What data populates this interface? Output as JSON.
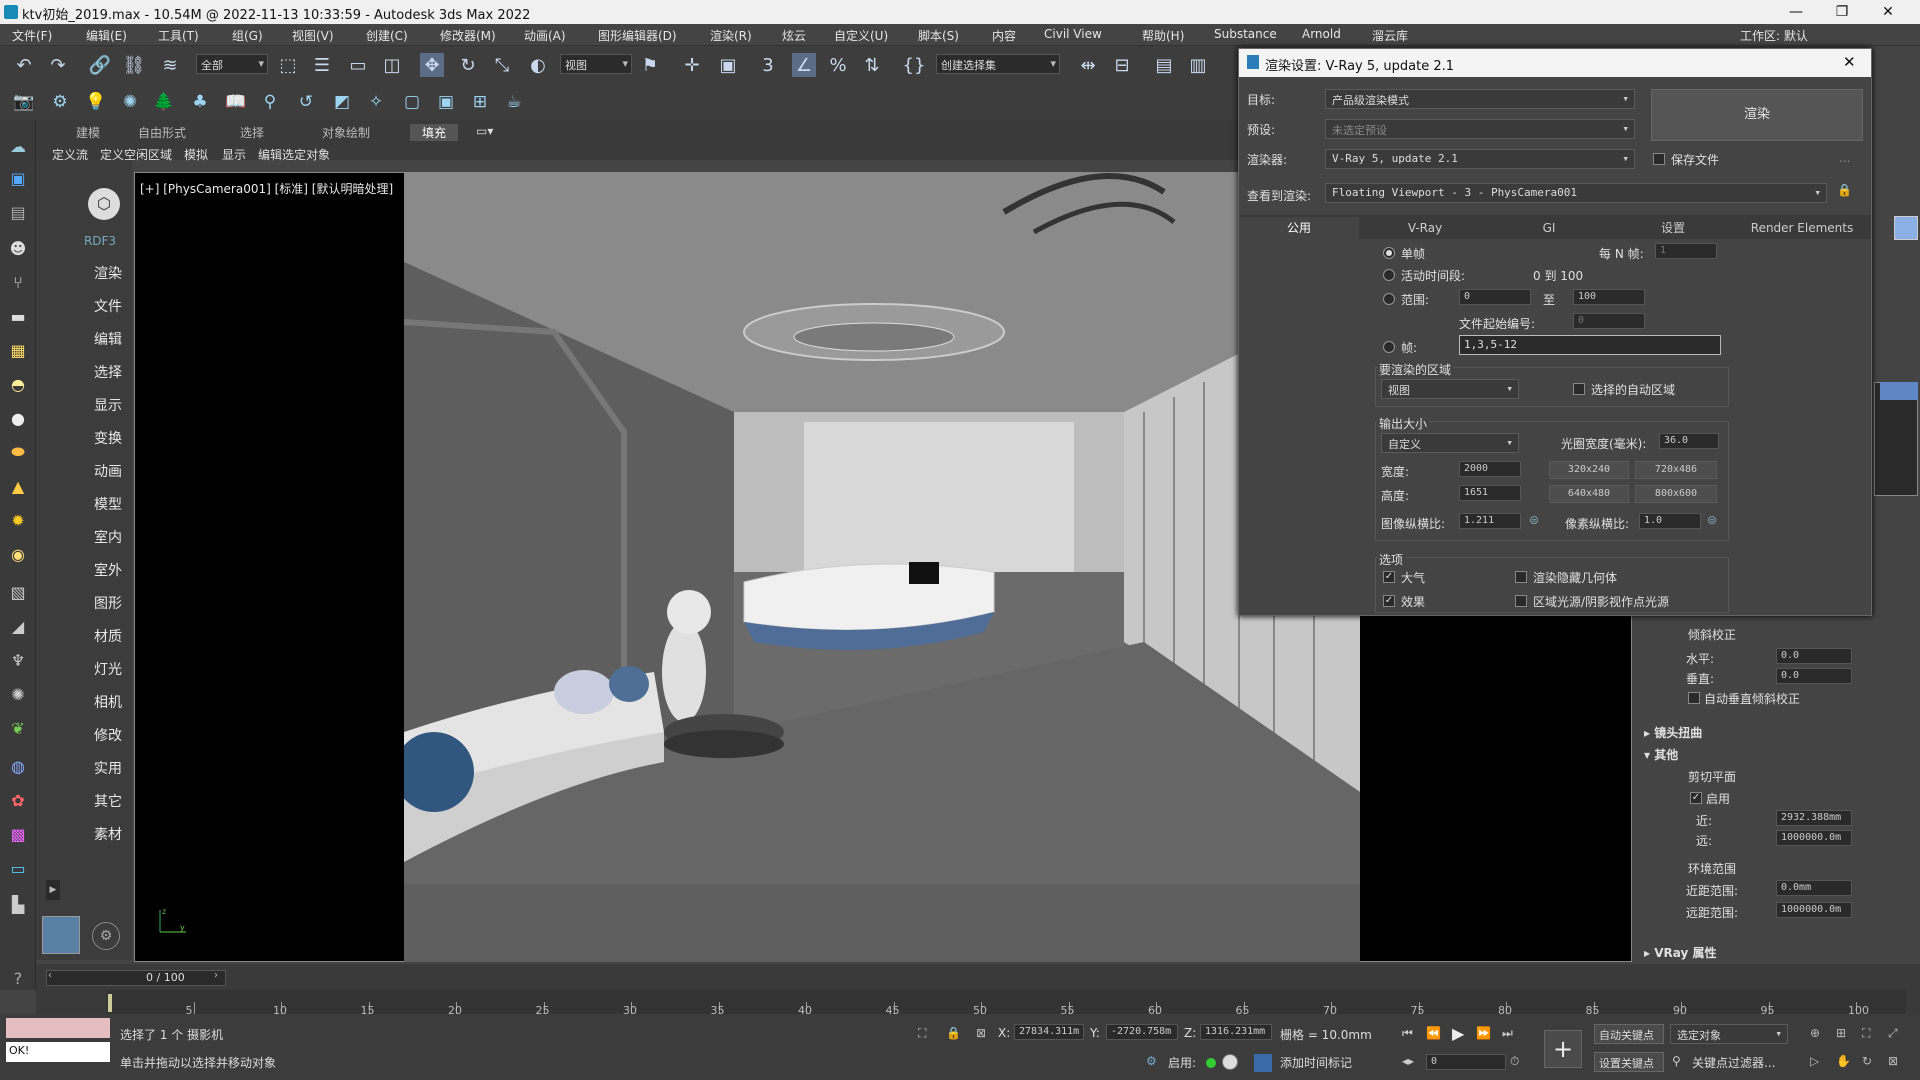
{
  "titlebar": {
    "title": "ktv初始_2019.max - 10.54M @ 2022-11-13 10:33:59 - Autodesk 3ds Max 2022",
    "min": "—",
    "max": "❐",
    "close": "✕"
  },
  "menubar": {
    "items": [
      "文件(F)",
      "编辑(E)",
      "工具(T)",
      "组(G)",
      "视图(V)",
      "创建(C)",
      "修改器(M)",
      "动画(A)",
      "图形编辑器(D)",
      "渲染(R)",
      "炫云",
      "自定义(U)",
      "脚本(S)",
      "内容",
      "Civil View",
      "帮助(H)",
      "Substance",
      "Arnold",
      "溜云库"
    ],
    "workspace": "工作区: 默认"
  },
  "toolbar": {
    "filter": "全部",
    "view": "视图",
    "selection_set": "创建选择集"
  },
  "ribbon": {
    "tabs": [
      "建模",
      "自由形式",
      "选择",
      "对象绘制",
      "填充"
    ],
    "subtabs": [
      "定义流",
      "定义空闲区域",
      "模拟",
      "显示",
      "编辑选定对象"
    ]
  },
  "leftpanel": {
    "items": [
      "RDF3",
      "渲染",
      "文件",
      "编辑",
      "选择",
      "显示",
      "变换",
      "动画",
      "模型",
      "室内",
      "室外",
      "图形",
      "材质",
      "灯光",
      "相机",
      "修改",
      "实用",
      "其它",
      "素材"
    ]
  },
  "viewport": {
    "label": "[+] [PhysCamera001] [标准] [默认明暗处理]"
  },
  "dialog": {
    "title": "渲染设置: V-Ray 5, update 2.1",
    "target_label": "目标:",
    "target_value": "产品级渲染模式",
    "preset_label": "预设:",
    "preset_value": "未选定预设",
    "renderer_label": "渲染器:",
    "renderer_value": "V-Ray 5, update 2.1",
    "render_button": "渲染",
    "save_file": "保存文件",
    "view_label": "查看到渲染:",
    "view_value": "Floating Viewport - 3 - PhysCamera001",
    "tabs": [
      "公用",
      "V-Ray",
      "GI",
      "设置",
      "Render Elements"
    ],
    "single": "单帧",
    "every_n": "每 N 帧:",
    "every_n_value": "1",
    "active_segment": "活动时间段:",
    "active_range": "0 到 100",
    "range": "范围:",
    "range_from": "0",
    "range_to_label": "至",
    "range_to": "100",
    "file_start": "文件起始编号:",
    "file_start_value": "0",
    "frames": "帧:",
    "frames_value": "1,3,5-12",
    "area_title": "要渲染的区域",
    "area_value": "视图",
    "auto_region": "选择的自动区域",
    "output_title": "输出大小",
    "output_value": "自定义",
    "aperture_label": "光圈宽度(毫米):",
    "aperture_value": "36.0",
    "width_label": "宽度:",
    "width_value": "2000",
    "height_label": "高度:",
    "height_value": "1651",
    "presets": [
      "320x240",
      "720x486",
      "640x480",
      "800x600"
    ],
    "image_aspect_label": "图像纵横比:",
    "image_aspect_value": "1.211",
    "pixel_aspect_label": "像素纵横比:",
    "pixel_aspect_value": "1.0",
    "options_title": "选项",
    "atmosphere": "大气",
    "render_hidden": "渲染隐藏几何体",
    "effects": "效果",
    "area_lights": "区域光源/阴影视作点光源"
  },
  "rightpanel": {
    "tilt_title": "倾斜校正",
    "horizontal": "水平:",
    "horizontal_value": "0.0",
    "vertical": "垂直:",
    "vertical_value": "0.0",
    "auto_vertical": "自动垂直倾斜校正",
    "lens_distortion": "镜头扭曲",
    "misc": "其他",
    "clip_planes": "剪切平面",
    "enable": "启用",
    "near": "近:",
    "near_value": "2932.388mm",
    "far": "远:",
    "far_value": "1000000.0m",
    "env_range": "环境范围",
    "near_range": "近距范围:",
    "near_range_value": "0.0mm",
    "far_range": "远距范围:",
    "far_range_value": "1000000.0m",
    "vray_props": "VRay 属性"
  },
  "timeline": {
    "frame": "0 / 100",
    "ticks": [
      "5",
      "10",
      "15",
      "20",
      "25",
      "30",
      "35",
      "40",
      "45",
      "50",
      "55",
      "60",
      "65",
      "70",
      "75",
      "80",
      "85",
      "90",
      "95",
      "100"
    ]
  },
  "status": {
    "selected": "选择了 1 个 摄影机",
    "hint": "单击并拖动以选择并移动对象",
    "ok": "OK!",
    "x_label": "X:",
    "x_value": "27834.311m",
    "y_label": "Y:",
    "y_value": "-2720.758m",
    "z_label": "Z:",
    "z_value": "1316.231mm",
    "grid": "栅格 = 10.0mm",
    "enable": "启用:",
    "add_time_tag": "添加时间标记",
    "auto_key": "自动关键点",
    "selected_obj": "选定对象",
    "set_key": "设置关键点",
    "key_filter": "关键点过滤器...",
    "frame_input": "0"
  }
}
